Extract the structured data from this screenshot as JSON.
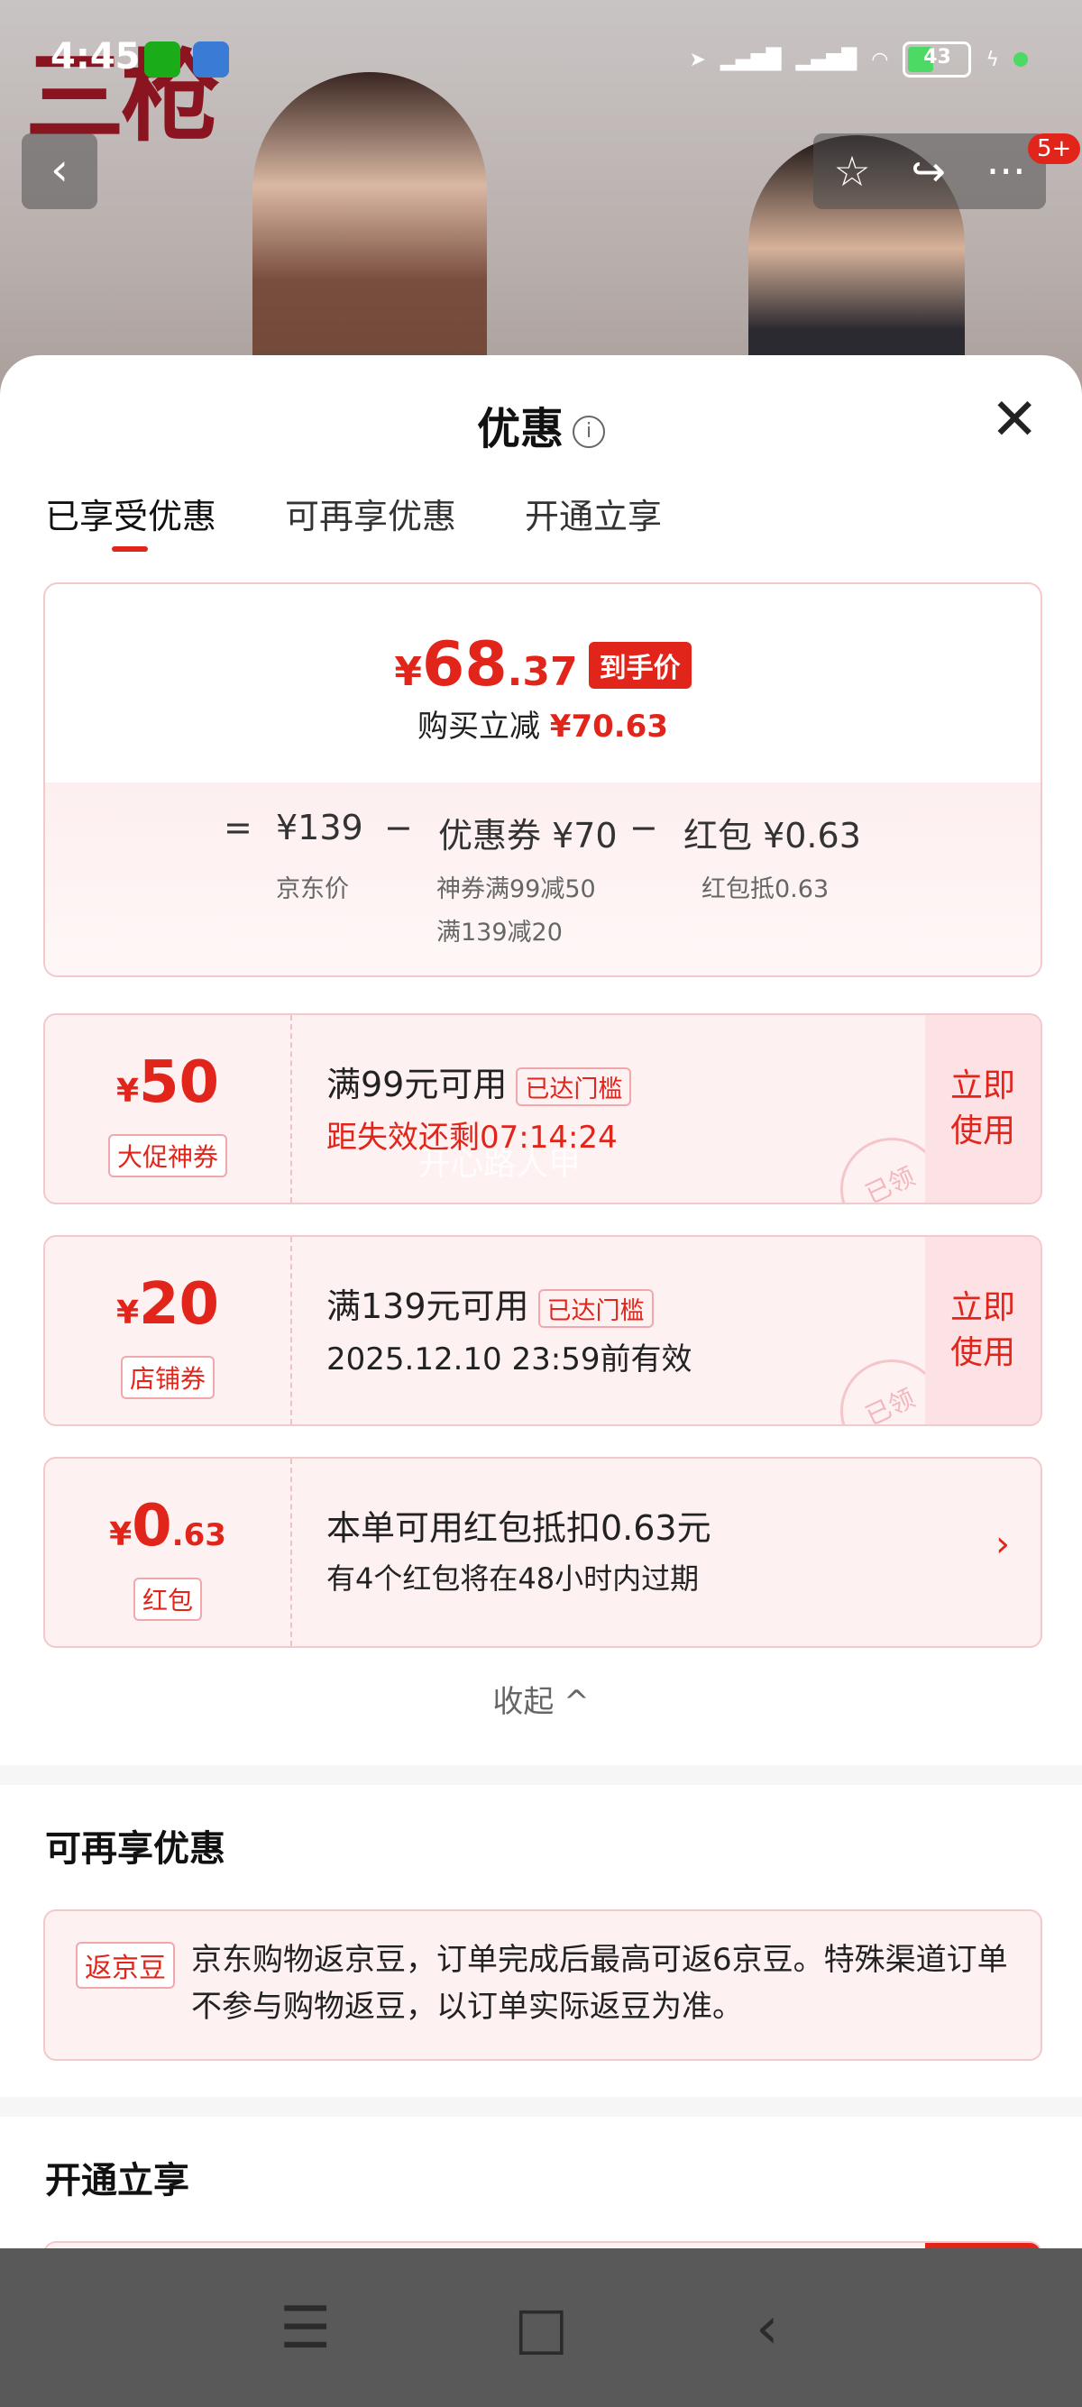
{
  "status_bar": {
    "time": "4:45",
    "battery": "43"
  },
  "hero": {
    "brand": "三枪"
  },
  "top_actions": {
    "badge": "5+"
  },
  "sheet": {
    "title": "优惠",
    "tabs": [
      "已享受优惠",
      "可再享优惠",
      "开通立享"
    ]
  },
  "price_card": {
    "currency": "¥",
    "price_int": "68",
    "price_dec": ".37",
    "price_tag": "到手价",
    "reduce_label": "购买立减",
    "reduce_value": "¥70.63",
    "eq": "=",
    "jd_price": "¥139",
    "jd_price_label": "京东价",
    "minus1": "−",
    "coupon_label": "优惠券 ¥70",
    "coupon_sub1": "神券满99减50",
    "coupon_sub2": "满139减20",
    "minus2": "−",
    "hongbao_label": "红包 ¥0.63",
    "hongbao_sub": "红包抵0.63"
  },
  "coupons": [
    {
      "cur": "¥",
      "num": "50",
      "dec": "",
      "tag": "大促神券",
      "main": "满99元可用",
      "reach": "已达门槛",
      "second": "距失效还剩07:14:24",
      "use1": "立即",
      "use2": "使用",
      "stamp": "已领"
    },
    {
      "cur": "¥",
      "num": "20",
      "dec": "",
      "tag": "店铺券",
      "main": "满139元可用",
      "reach": "已达门槛",
      "second": "2025.12.10 23:59前有效",
      "use1": "立即",
      "use2": "使用",
      "stamp": "已领"
    },
    {
      "cur": "¥",
      "num": "0",
      "dec": ".63",
      "tag": "红包",
      "main": "本单可用红包抵扣0.63元",
      "second": "有4个红包将在48小时内过期"
    }
  ],
  "watermark": "开心路人甲",
  "collapse": "收起 ^",
  "more": {
    "title": "可再享优惠",
    "tag": "返京豆",
    "text": "京东购物返京豆，订单完成后最高可返6京豆。特殊渠道订单不参与购物返豆，以订单实际返豆为准。"
  },
  "open": {
    "title": "开通立享"
  },
  "colors": {
    "accent": "#e1251b",
    "card_bg": "#fdf1f2",
    "border": "#f3c9cc"
  }
}
